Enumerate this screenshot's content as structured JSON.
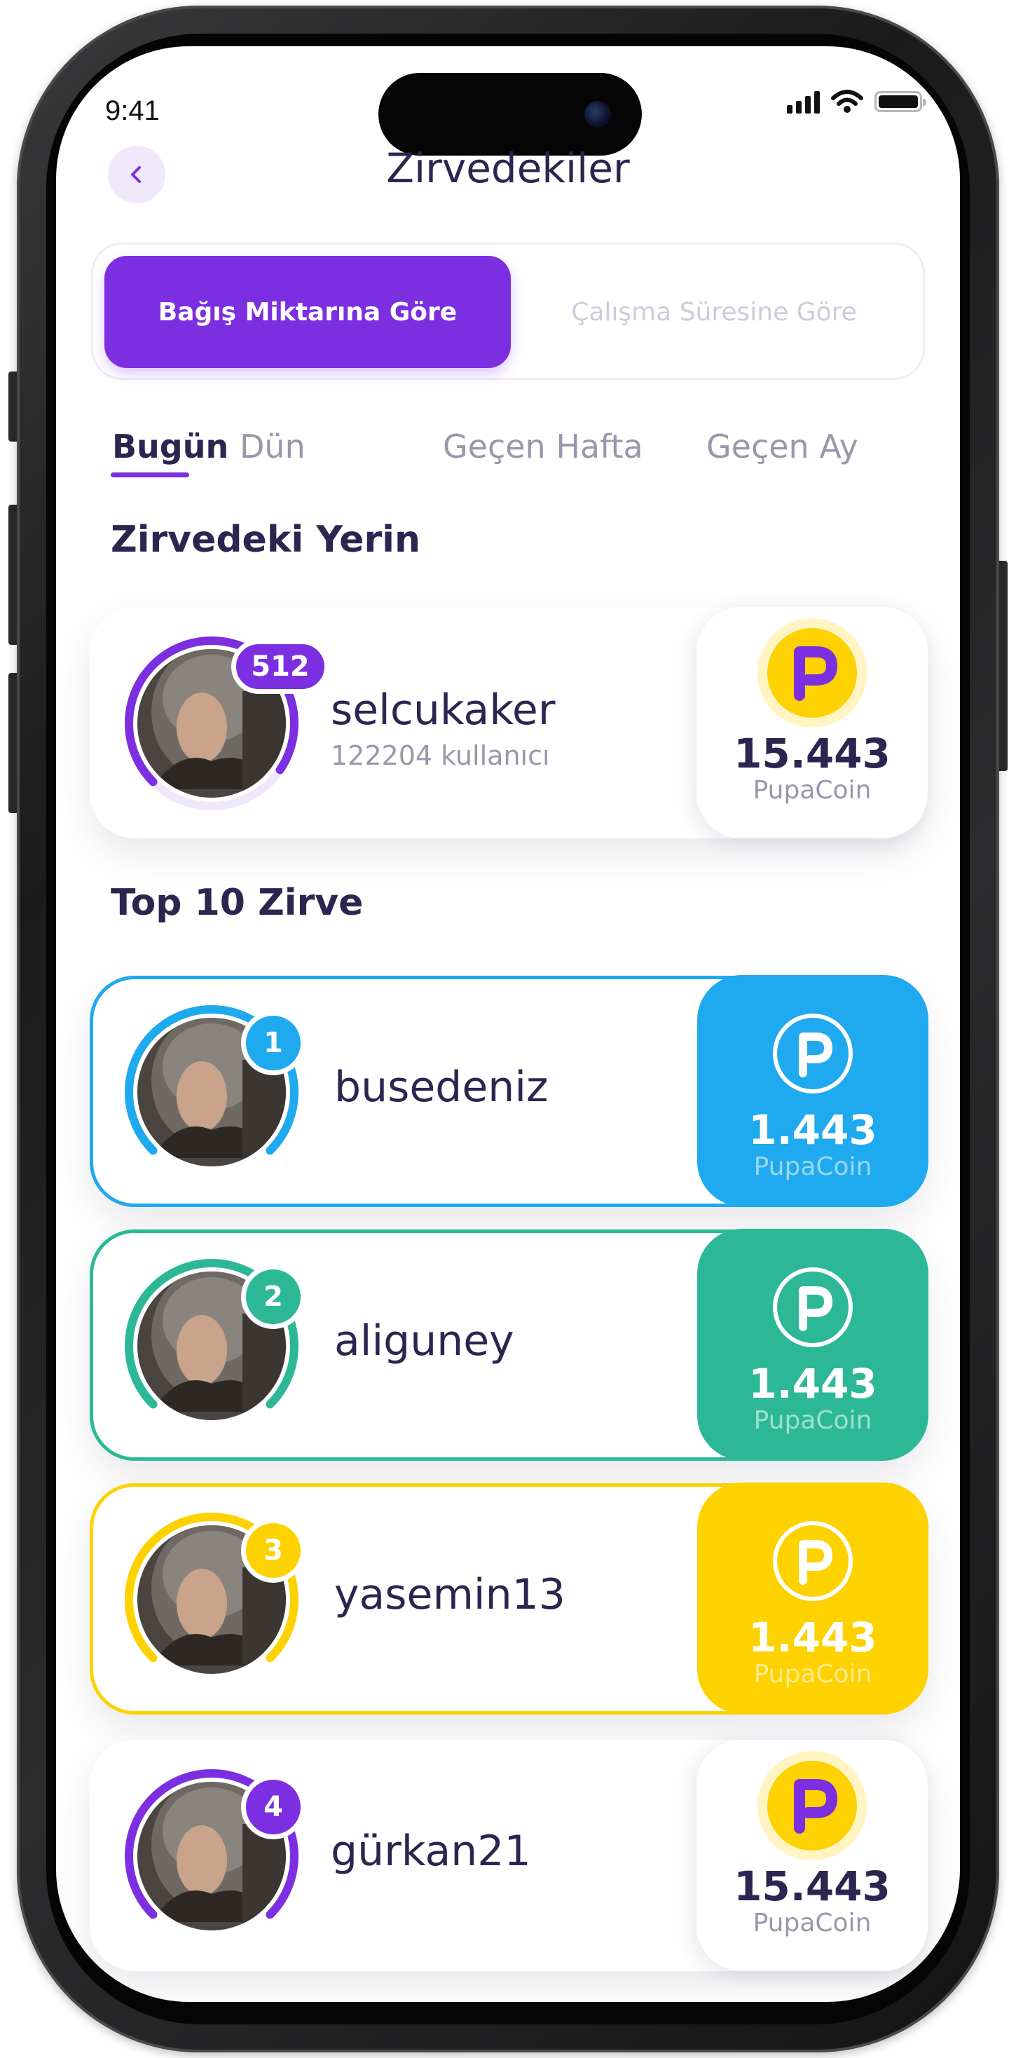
{
  "status_bar": {
    "time": "9:41",
    "signal_icon": "signal-icon",
    "wifi_icon": "wifi-icon",
    "battery_icon": "battery-icon"
  },
  "header": {
    "title": "Zirvedekiler",
    "back_icon": "chevron-left-icon"
  },
  "sort_segment": {
    "active": "Bağış Miktarına Göre",
    "inactive": "Çalışma Süresine Göre"
  },
  "period_tabs": [
    "Bugün",
    "Dün",
    "Geçen Hafta",
    "Geçen Ay"
  ],
  "sections": {
    "my_rank": "Zirvedeki Yerin",
    "top10": "Top 10 Zirve"
  },
  "my_entry": {
    "rank": "512",
    "username": "selcukaker",
    "subtitle": "122204 kullanıcı",
    "amount": "15.443",
    "unit": "PupaCoin",
    "ring_fraction": 0.72
  },
  "leaders": [
    {
      "rank": "1",
      "username": "busedeniz",
      "amount": "1.443",
      "unit": "PupaCoin",
      "color": "#1fa9ee",
      "style": "outlined"
    },
    {
      "rank": "2",
      "username": "aliguney",
      "amount": "1.443",
      "unit": "PupaCoin",
      "color": "#2cb896",
      "style": "outlined"
    },
    {
      "rank": "3",
      "username": "yasemin13",
      "amount": "1.443",
      "unit": "PupaCoin",
      "color": "#fdd200",
      "style": "outlined"
    },
    {
      "rank": "4",
      "username": "gürkan21",
      "amount": "15.443",
      "unit": "PupaCoin",
      "color": "#7c2fe0",
      "style": "plain"
    }
  ],
  "colors": {
    "accent": "#7c2fe0",
    "title": "#2d2550",
    "coin_yellow": "#fdd200"
  }
}
